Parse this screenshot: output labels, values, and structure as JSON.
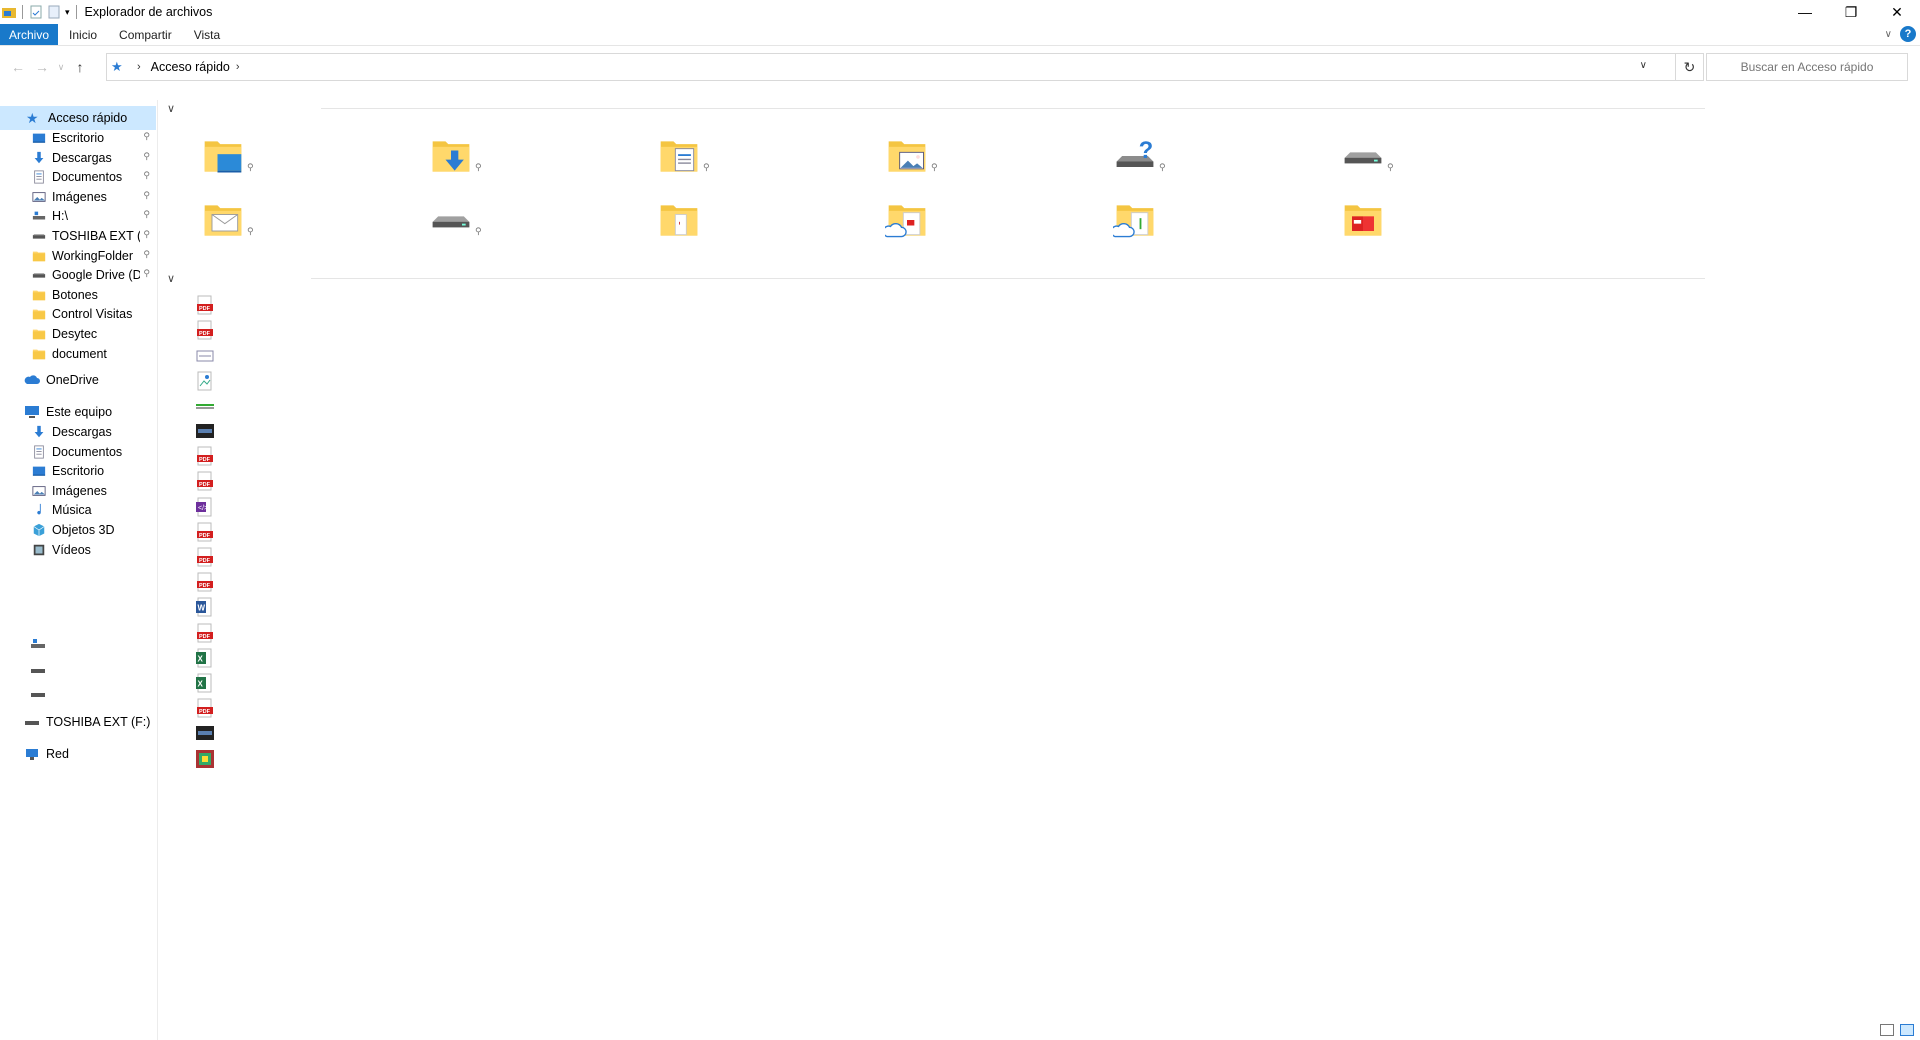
{
  "window": {
    "title": "Explorador de archivos"
  },
  "ribbon": {
    "tabs": [
      "Archivo",
      "Inicio",
      "Compartir",
      "Vista"
    ]
  },
  "address": {
    "location": "Acceso rápido",
    "search_placeholder": "Buscar en Acceso rápido"
  },
  "sidebar": {
    "quick_access": "Acceso rápido",
    "pinned": [
      {
        "label": "Escritorio",
        "icon": "desktop-icon",
        "pinned": true
      },
      {
        "label": "Descargas",
        "icon": "downloads-icon",
        "pinned": true
      },
      {
        "label": "Documentos",
        "icon": "documents-icon",
        "pinned": true
      },
      {
        "label": "Imágenes",
        "icon": "pictures-icon",
        "pinned": true
      },
      {
        "label": "H:\\",
        "icon": "network-drive-icon",
        "pinned": true
      },
      {
        "label": "TOSHIBA EXT (F:)",
        "icon": "drive-icon",
        "pinned": true
      },
      {
        "label": "WorkingFolder",
        "icon": "folder-icon",
        "pinned": true
      },
      {
        "label": "Google Drive (D:)",
        "icon": "drive-icon",
        "pinned": true
      },
      {
        "label": "Botones",
        "icon": "folder-icon",
        "pinned": false
      },
      {
        "label": "Control Visitas",
        "icon": "folder-icon",
        "pinned": false
      },
      {
        "label": "Desytec",
        "icon": "folder-icon",
        "pinned": false
      },
      {
        "label": "document",
        "icon": "folder-icon",
        "pinned": false
      }
    ],
    "onedrive": "OneDrive",
    "this_pc": "Este equipo",
    "pc_items": [
      {
        "label": "Descargas",
        "icon": "downloads-icon"
      },
      {
        "label": "Documentos",
        "icon": "documents-icon"
      },
      {
        "label": "Escritorio",
        "icon": "desktop-icon"
      },
      {
        "label": "Imágenes",
        "icon": "pictures-icon"
      },
      {
        "label": "Música",
        "icon": "music-icon"
      },
      {
        "label": "Objetos 3D",
        "icon": "3d-objects-icon"
      },
      {
        "label": "Vídeos",
        "icon": "videos-icon"
      }
    ],
    "drives_unlabeled": [
      "network-drive-icon",
      "drive-icon",
      "drive-icon"
    ],
    "toshiba": "TOSHIBA EXT (F:)",
    "network": "Red"
  },
  "main": {
    "frequent_folders": [
      {
        "icon": "desktop-folder-icon",
        "pinned": true
      },
      {
        "icon": "downloads-folder-icon",
        "pinned": true
      },
      {
        "icon": "documents-folder-icon",
        "pinned": true
      },
      {
        "icon": "pictures-folder-icon",
        "pinned": true
      },
      {
        "icon": "unknown-drive-icon",
        "pinned": true
      },
      {
        "icon": "drive-icon",
        "pinned": true
      },
      {
        "icon": "mail-folder-icon",
        "pinned": true
      },
      {
        "icon": "drive-icon",
        "pinned": true
      },
      {
        "icon": "folder-icon",
        "pinned": false
      },
      {
        "icon": "onedrive-pdf-folder-icon",
        "pinned": false
      },
      {
        "icon": "onedrive-folder-icon",
        "pinned": false
      },
      {
        "icon": "pdf-folder-icon",
        "pinned": false
      }
    ],
    "recent_files": [
      "pdf",
      "pdf",
      "generic",
      "image",
      "green",
      "dark",
      "pdf",
      "pdf",
      "vs",
      "pdf",
      "pdf",
      "pdf",
      "word",
      "pdf",
      "excel",
      "excel",
      "pdf",
      "dark",
      "media"
    ]
  }
}
